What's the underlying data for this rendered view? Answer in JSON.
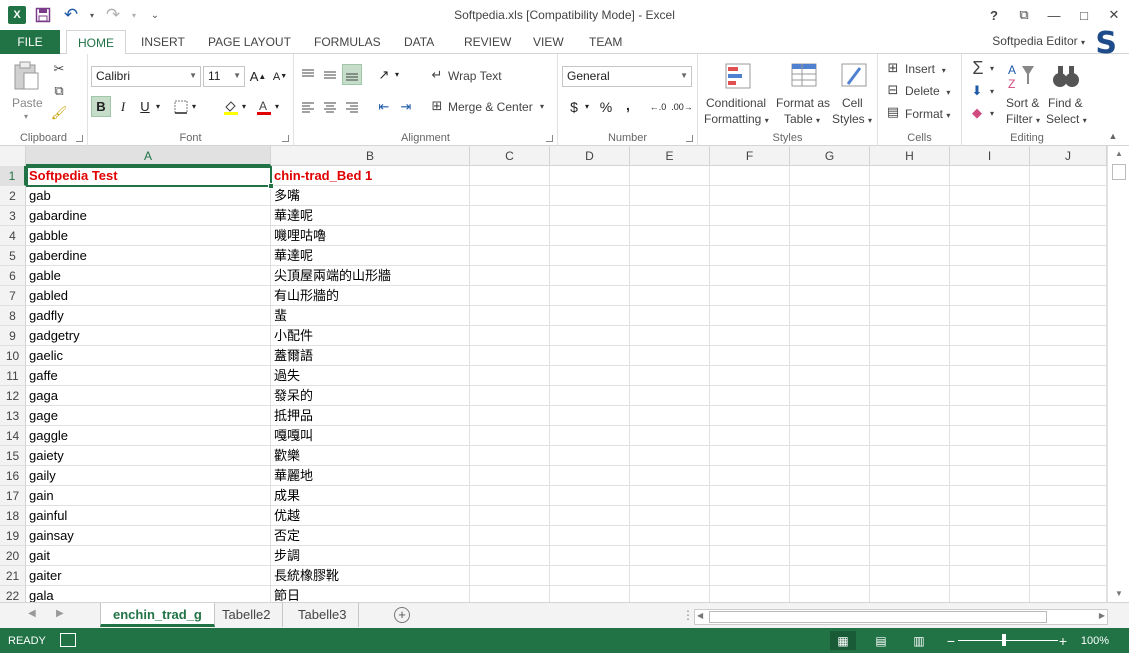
{
  "window": {
    "title": "Softpedia.xls  [Compatibility Mode] - Excel",
    "help": "?",
    "ribbon_display": "⧉",
    "minimize": "—",
    "maximize": "□",
    "close": "✕"
  },
  "qat": {
    "app_icon": "X",
    "save": "💾",
    "undo": "↶",
    "redo": "↷",
    "customize": "⌄"
  },
  "tabs": [
    {
      "label": "FILE"
    },
    {
      "label": "HOME"
    },
    {
      "label": "INSERT"
    },
    {
      "label": "PAGE LAYOUT"
    },
    {
      "label": "FORMULAS"
    },
    {
      "label": "DATA"
    },
    {
      "label": "REVIEW"
    },
    {
      "label": "VIEW"
    },
    {
      "label": "TEAM"
    }
  ],
  "account": "Softpedia Editor",
  "softpedia_logo": "S",
  "ribbon": {
    "clipboard": {
      "label": "Clipboard",
      "paste": "Paste"
    },
    "font": {
      "label": "Font",
      "font_name": "Calibri",
      "font_size": "11",
      "grow": "A",
      "shrink": "A",
      "bold": "B",
      "italic": "I",
      "underline": "U"
    },
    "alignment": {
      "label": "Alignment",
      "wrap": "Wrap Text",
      "merge": "Merge & Center"
    },
    "number": {
      "label": "Number",
      "format": "General",
      "currency": "$",
      "percent": "%",
      "comma": ","
    },
    "styles": {
      "label": "Styles",
      "conditional_1": "Conditional",
      "conditional_2": "Formatting",
      "format_table_1": "Format as",
      "format_table_2": "Table",
      "cell_styles_1": "Cell",
      "cell_styles_2": "Styles"
    },
    "cells": {
      "label": "Cells",
      "insert": "Insert",
      "delete": "Delete",
      "format": "Format"
    },
    "editing": {
      "label": "Editing",
      "sum": "Σ",
      "sort_1": "Sort &",
      "sort_2": "Filter",
      "find_1": "Find &",
      "find_2": "Select"
    }
  },
  "columns": [
    "A",
    "B",
    "C",
    "D",
    "E",
    "F",
    "G",
    "H",
    "I",
    "J"
  ],
  "rows": [
    {
      "n": "1",
      "a": "Softpedia Test",
      "b": "chin-trad_Bed 1"
    },
    {
      "n": "2",
      "a": "gab",
      "b": "多嘴"
    },
    {
      "n": "3",
      "a": "gabardine",
      "b": "華達呢"
    },
    {
      "n": "4",
      "a": "gabble",
      "b": "嘰哩咕嚕"
    },
    {
      "n": "5",
      "a": "gaberdine",
      "b": "華達呢"
    },
    {
      "n": "6",
      "a": "gable",
      "b": "尖頂屋兩端的山形牆"
    },
    {
      "n": "7",
      "a": "gabled",
      "b": "有山形牆的"
    },
    {
      "n": "8",
      "a": "gadfly",
      "b": "蜚"
    },
    {
      "n": "9",
      "a": "gadgetry",
      "b": "小配件"
    },
    {
      "n": "10",
      "a": "gaelic",
      "b": "蓋爾語"
    },
    {
      "n": "11",
      "a": "gaffe",
      "b": "過失"
    },
    {
      "n": "12",
      "a": "gaga",
      "b": "發呆的"
    },
    {
      "n": "13",
      "a": "gage",
      "b": "抵押品"
    },
    {
      "n": "14",
      "a": "gaggle",
      "b": "嘎嘎叫"
    },
    {
      "n": "15",
      "a": "gaiety",
      "b": "歡樂"
    },
    {
      "n": "16",
      "a": "gaily",
      "b": "華麗地"
    },
    {
      "n": "17",
      "a": "gain",
      "b": "成果"
    },
    {
      "n": "18",
      "a": "gainful",
      "b": "优越"
    },
    {
      "n": "19",
      "a": "gainsay",
      "b": "否定"
    },
    {
      "n": "20",
      "a": "gait",
      "b": "步調"
    },
    {
      "n": "21",
      "a": "gaiter",
      "b": "長統橡膠靴"
    },
    {
      "n": "22",
      "a": "gala",
      "b": "節日"
    }
  ],
  "sheets": [
    "enchin_trad_g",
    "Tabelle2",
    "Tabelle3"
  ],
  "add_sheet": "+",
  "status": {
    "ready": "READY",
    "zoom": "100%",
    "zoom_minus": "−",
    "zoom_plus": "+"
  },
  "colors": {
    "accent": "#217346",
    "header_text": "#e00000"
  }
}
